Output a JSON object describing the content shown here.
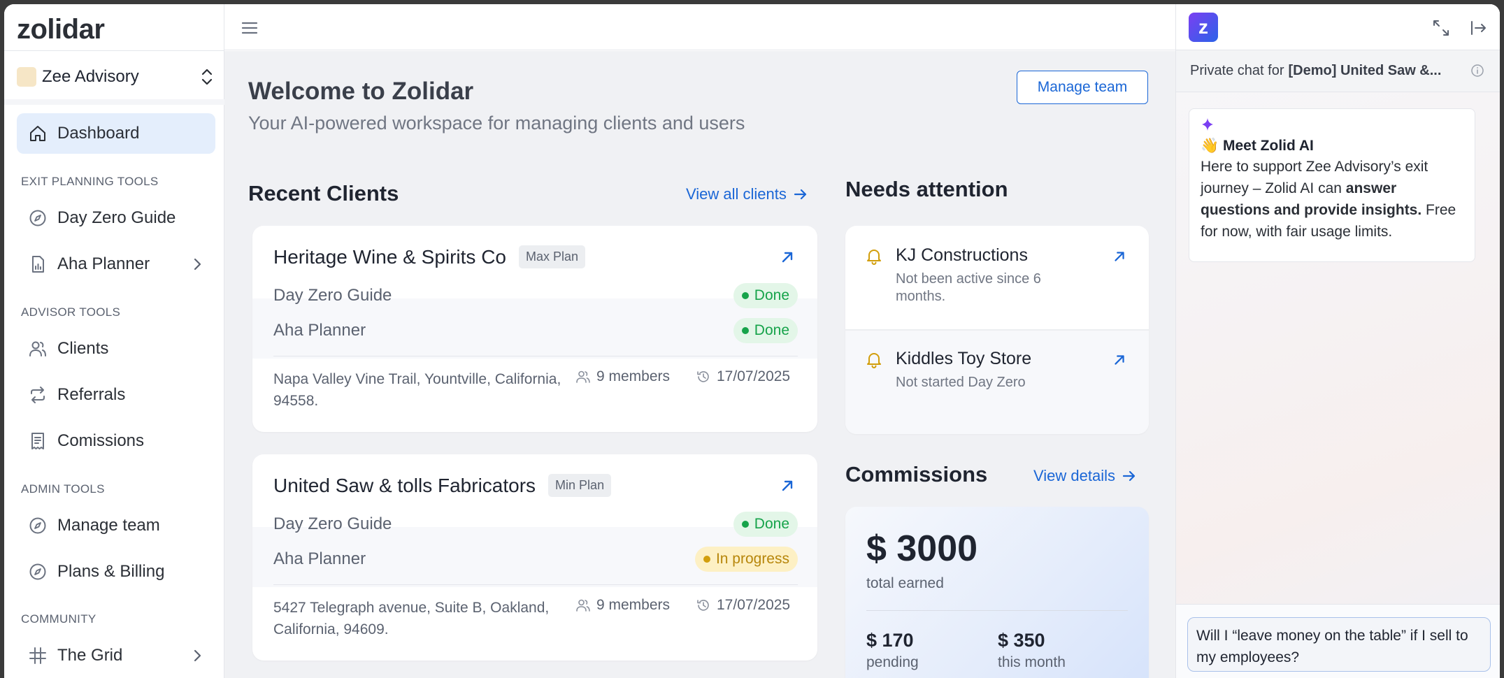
{
  "app": {
    "logo": "zolidar"
  },
  "org": {
    "name": "Zee Advisory"
  },
  "sidebar": {
    "dashboard": "Dashboard",
    "sections": {
      "exit_planning": "EXIT PLANNING TOOLS",
      "advisor": "ADVISOR TOOLS",
      "admin": "ADMIN TOOLS",
      "community": "COMMUNITY"
    },
    "items": {
      "day_zero_guide": "Day Zero Guide",
      "aha_planner": "Aha Planner",
      "clients": "Clients",
      "referrals": "Referrals",
      "comissions": "Comissions",
      "manage_team": "Manage team",
      "plans_billing": "Plans & Billing",
      "the_grid": "The Grid"
    }
  },
  "welcome": {
    "title": "Welcome to Zolidar",
    "subtitle": "Your AI-powered workspace for managing clients and users",
    "manage_team_button": "Manage team"
  },
  "recent_clients": {
    "heading": "Recent Clients",
    "view_all": "View all clients",
    "clients": [
      {
        "name": "Heritage Wine & Spirits Co",
        "plan": "Max Plan",
        "tools": [
          {
            "name": "Day Zero Guide",
            "status": "Done"
          },
          {
            "name": "Aha Planner",
            "status": "Done"
          }
        ],
        "address": "Napa Valley Vine Trail, Yountville, California, 94558.",
        "members": "9 members",
        "date": "17/07/2025"
      },
      {
        "name": "United Saw & tolls Fabricators",
        "plan": "Min Plan",
        "tools": [
          {
            "name": "Day Zero Guide",
            "status": "Done"
          },
          {
            "name": "Aha Planner",
            "status": "In progress"
          }
        ],
        "address": "5427 Telegraph avenue, Suite B, Oakland, California, 94609.",
        "members": "9 members",
        "date": "17/07/2025"
      }
    ]
  },
  "needs_attention": {
    "heading": "Needs attention",
    "items": [
      {
        "name": "KJ Constructions",
        "desc": "Not been active since 6 months."
      },
      {
        "name": "Kiddles Toy Store",
        "desc": "Not started Day Zero"
      }
    ]
  },
  "commissions": {
    "heading": "Commissions",
    "view_details": "View details",
    "total": "$ 3000",
    "total_label": "total earned",
    "pending": "$ 170",
    "pending_label": "pending",
    "this_month": "$ 350",
    "this_month_label": "this month"
  },
  "chat": {
    "logo": "z",
    "header_prefix": "Private chat for",
    "header_target": "[Demo] United Saw &...",
    "meet_title": "👋 Meet Zolid AI",
    "body_1": "Here to support Zee Advisory’s exit journey – Zolid AI can ",
    "body_bold": "answer questions and provide insights.",
    "body_2": " Free for now, with fair usage limits.",
    "input_value": "Will I “leave money on the table” if I sell to my employees?"
  },
  "colors": {
    "accent": "#1a66d6",
    "active_nav_bg": "#e4eefc",
    "done": "#16a34a",
    "in_progress": "#b7860b",
    "bell": "#d29e0c"
  }
}
